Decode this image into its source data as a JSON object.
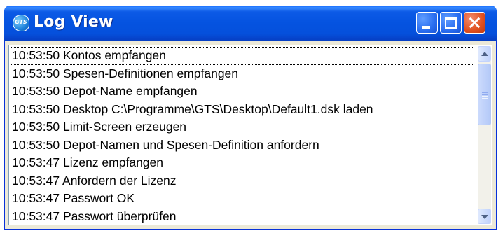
{
  "window": {
    "title": "Log View",
    "app_icon": "gts-app-icon",
    "app_icon_text": "GTS",
    "controls": [
      "minimize-icon",
      "maximize-icon",
      "close-icon"
    ]
  },
  "log": {
    "entries": [
      "10:53:50 Kontos empfangen",
      "10:53:50 Spesen-Definitionen empfangen",
      "10:53:50 Depot-Name empfangen",
      "10:53:50 Desktop C:\\Programme\\GTS\\Desktop\\Default1.dsk laden",
      "10:53:50 Limit-Screen erzeugen",
      "10:53:50 Depot-Namen und Spesen-Definition anfordern",
      "10:53:47 Lizenz empfangen",
      "10:53:47 Anfordern der Lizenz",
      "10:53:47 Passwort OK",
      "10:53:47 Passwort überprüfen"
    ],
    "focused_index": 0
  },
  "colors": {
    "titlebar": "#0553e0",
    "close_button": "#e0501f",
    "window_frame": "#ece9d8"
  }
}
